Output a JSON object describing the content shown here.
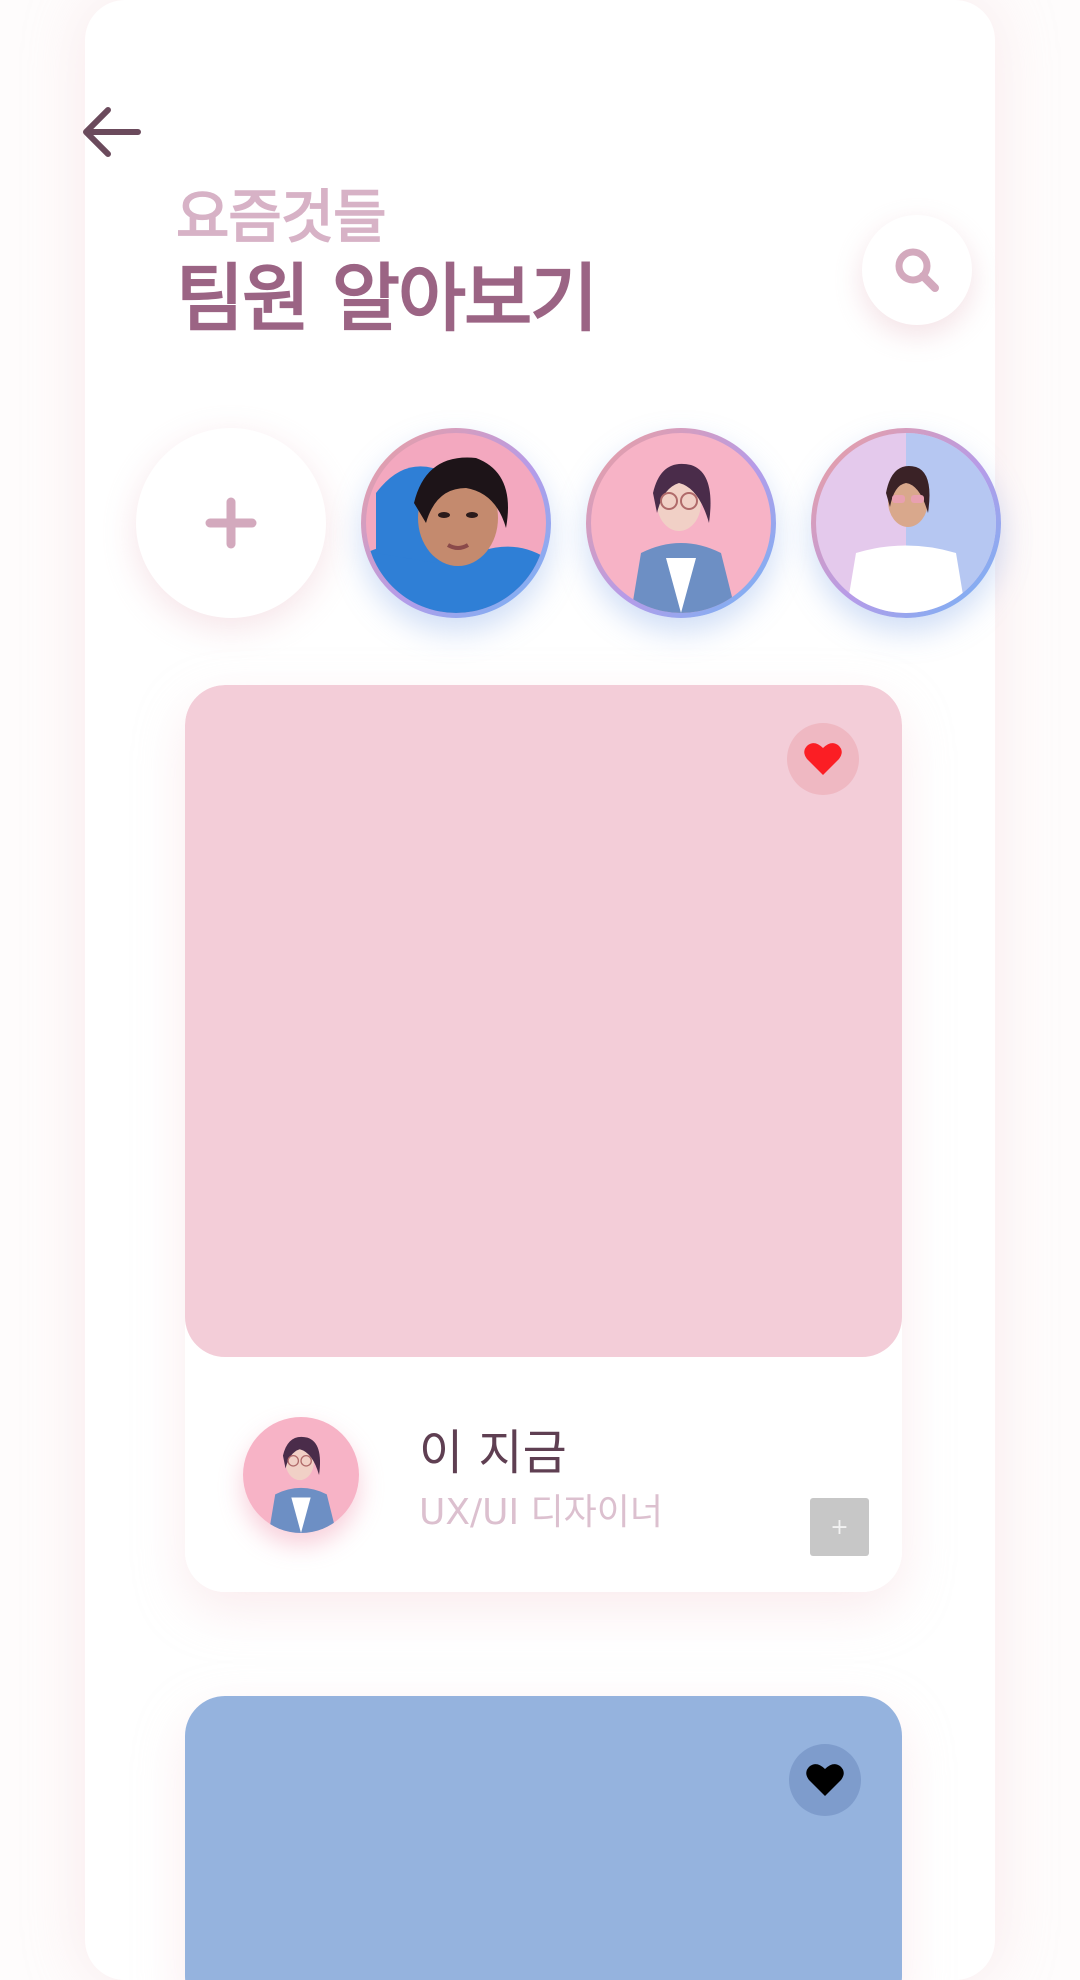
{
  "header": {
    "back_icon": "arrow-left-icon",
    "subtitle": "요즘것들",
    "title": "팀원 알아보기",
    "search_icon": "search-icon"
  },
  "stories": {
    "add_icon": "plus-icon",
    "items": [
      {
        "name": "",
        "ring_colors": [
          "#ef9f9b",
          "#b69be8",
          "#6fb5f6"
        ],
        "photo_bg": "#2f7fd6"
      },
      {
        "name": "",
        "ring_colors": [
          "#ef9f9b",
          "#b69be8",
          "#6fb5f6"
        ],
        "photo_bg": "#f7b3c6"
      },
      {
        "name": "",
        "ring_colors": [
          "#ef9f9b",
          "#b69be8",
          "#6fb5f6"
        ],
        "photo_bg": "#b6c7f2"
      }
    ]
  },
  "cards": [
    {
      "image_color": "#f3cdd8",
      "liked": true,
      "heart_color": "#fb1e24",
      "member_name": "이 지금",
      "member_role": "UX/UI 디자이너",
      "action_label": "+"
    },
    {
      "image_color": "#95b3de",
      "liked": false,
      "heart_color": "#000000"
    }
  ],
  "colors": {
    "title": "#9b6484",
    "subtitle": "#d7b2c6",
    "accent_pink": "#f3cdd8",
    "accent_blue": "#95b3de"
  }
}
